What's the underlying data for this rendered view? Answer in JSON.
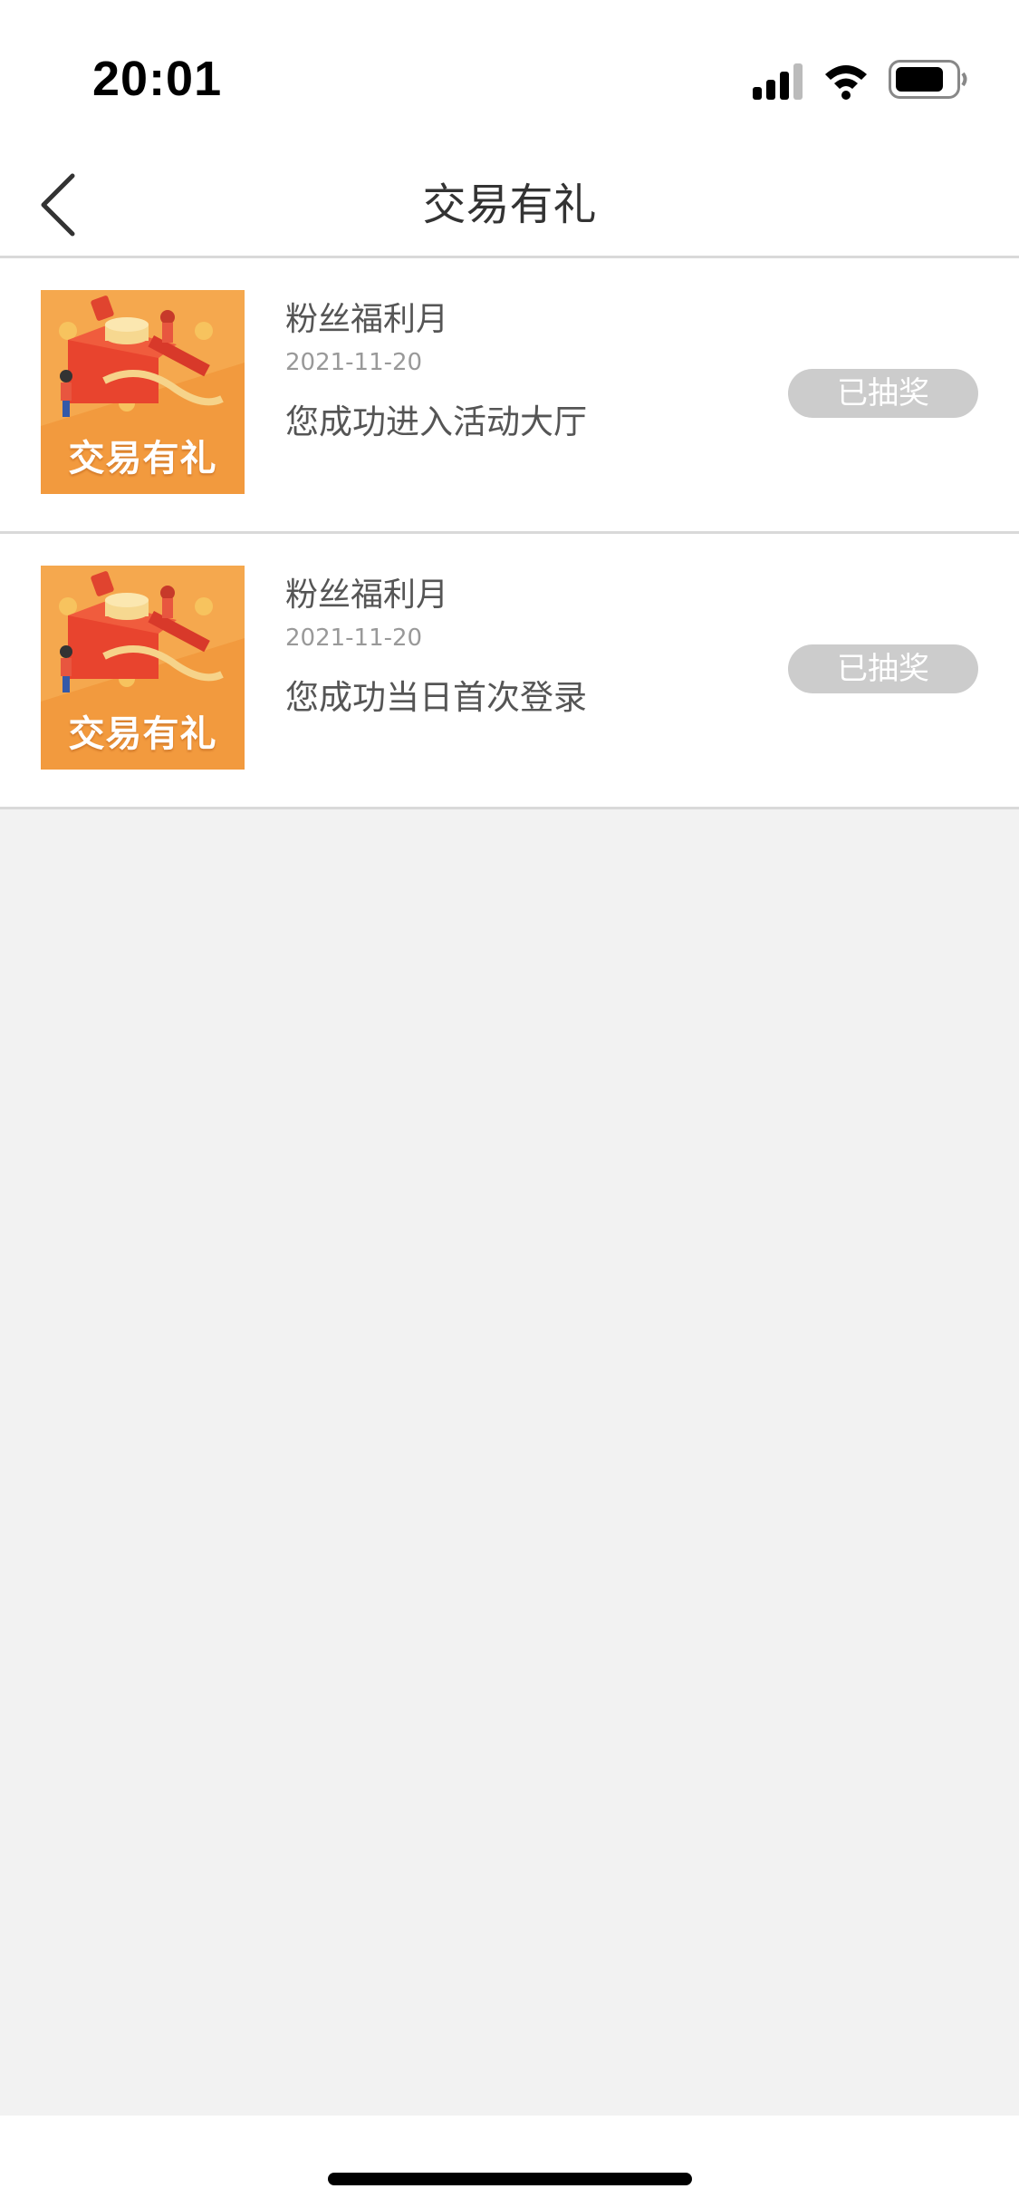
{
  "status_bar": {
    "time": "20:01",
    "icons": [
      "cellular-signal-icon",
      "wifi-icon",
      "battery-icon"
    ]
  },
  "nav": {
    "title": "交易有礼",
    "back_icon": "chevron-left-icon"
  },
  "items": [
    {
      "thumbnail_caption": "交易有礼",
      "title": "粉丝福利月",
      "date": "2021-11-20",
      "description": "您成功进入活动大厅",
      "status": "已抽奖"
    },
    {
      "thumbnail_caption": "交易有礼",
      "title": "粉丝福利月",
      "date": "2021-11-20",
      "description": "您成功当日首次登录",
      "status": "已抽奖"
    }
  ],
  "colors": {
    "background": "#f2f2f2",
    "card": "#ffffff",
    "divider": "#d9d9d9",
    "title_text": "#333333",
    "body_text": "#555555",
    "date_text": "#999999",
    "status_pill_bg": "#cccccc",
    "thumbnail_orange": "#f29a3e"
  }
}
